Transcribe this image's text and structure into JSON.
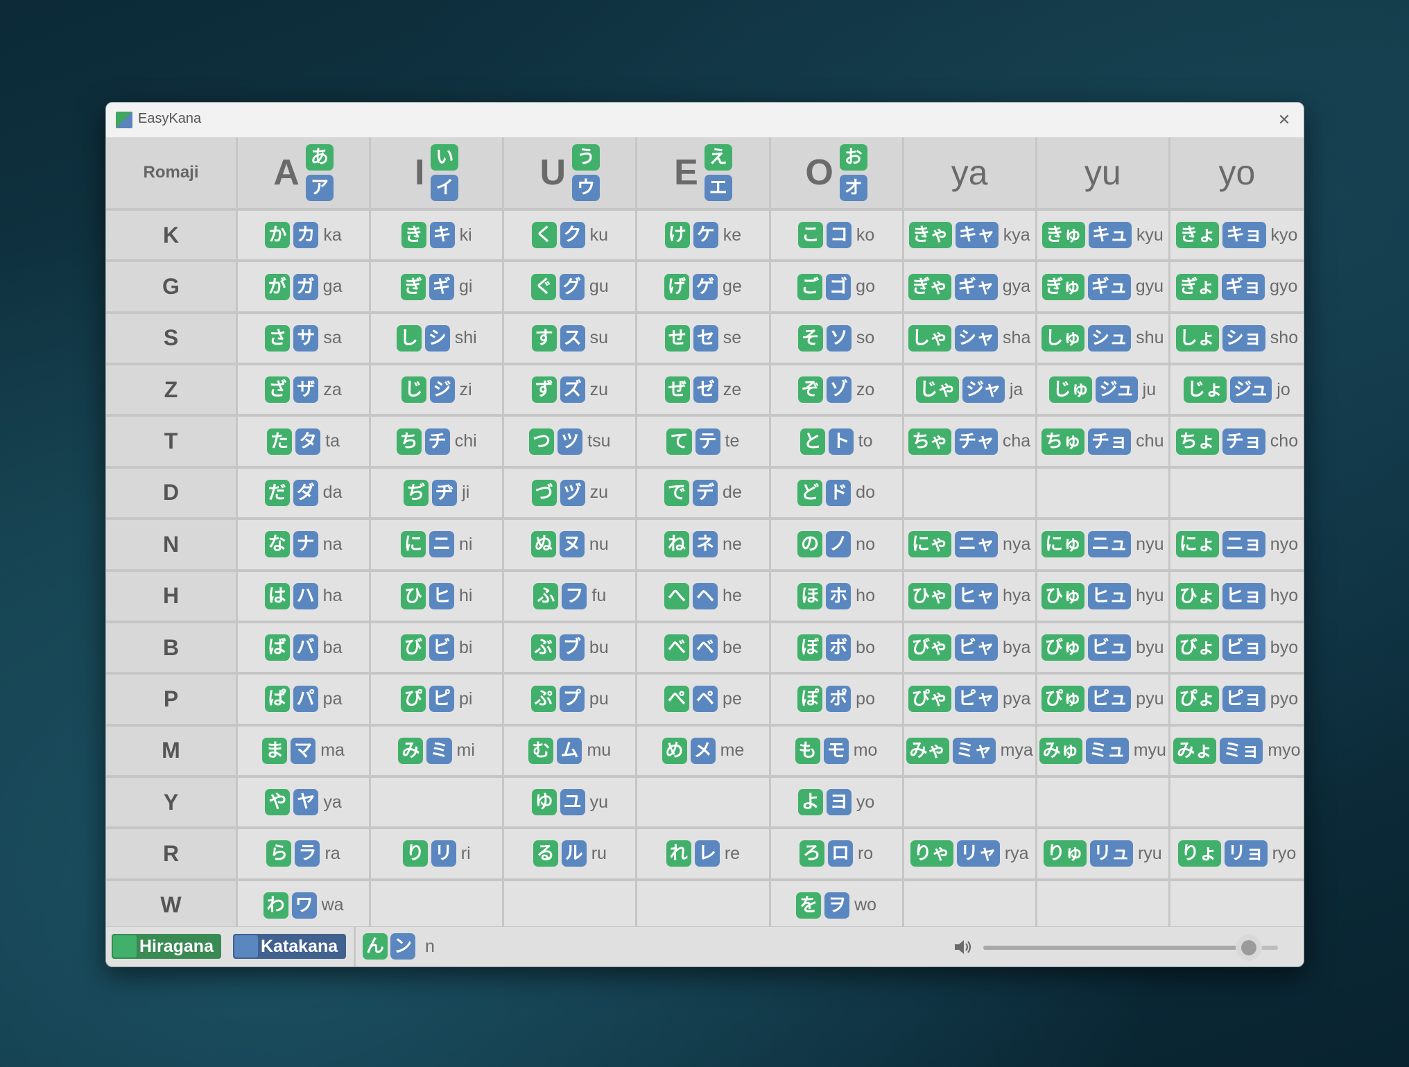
{
  "window": {
    "title": "EasyKana",
    "close_glyph": "✕"
  },
  "table": {
    "romaji_header": "Romaji",
    "columns": [
      {
        "letter": "A",
        "hira": "あ",
        "kata": "ア"
      },
      {
        "letter": "I",
        "hira": "い",
        "kata": "イ"
      },
      {
        "letter": "U",
        "hira": "う",
        "kata": "ウ"
      },
      {
        "letter": "E",
        "hira": "え",
        "kata": "エ"
      },
      {
        "letter": "O",
        "hira": "お",
        "kata": "オ"
      },
      {
        "label": "ya"
      },
      {
        "label": "yu"
      },
      {
        "label": "yo"
      }
    ],
    "rows": [
      {
        "label": "K",
        "cells": [
          {
            "h": "か",
            "k": "カ",
            "r": "ka"
          },
          {
            "h": "き",
            "k": "キ",
            "r": "ki"
          },
          {
            "h": "く",
            "k": "ク",
            "r": "ku"
          },
          {
            "h": "け",
            "k": "ケ",
            "r": "ke"
          },
          {
            "h": "こ",
            "k": "コ",
            "r": "ko"
          },
          {
            "h": "きゃ",
            "k": "キャ",
            "r": "kya"
          },
          {
            "h": "きゅ",
            "k": "キュ",
            "r": "kyu"
          },
          {
            "h": "きょ",
            "k": "キョ",
            "r": "kyo"
          }
        ]
      },
      {
        "label": "G",
        "cells": [
          {
            "h": "が",
            "k": "ガ",
            "r": "ga"
          },
          {
            "h": "ぎ",
            "k": "ギ",
            "r": "gi"
          },
          {
            "h": "ぐ",
            "k": "グ",
            "r": "gu"
          },
          {
            "h": "げ",
            "k": "ゲ",
            "r": "ge"
          },
          {
            "h": "ご",
            "k": "ゴ",
            "r": "go"
          },
          {
            "h": "ぎゃ",
            "k": "ギャ",
            "r": "gya"
          },
          {
            "h": "ぎゅ",
            "k": "ギュ",
            "r": "gyu"
          },
          {
            "h": "ぎょ",
            "k": "ギョ",
            "r": "gyo"
          }
        ]
      },
      {
        "label": "S",
        "cells": [
          {
            "h": "さ",
            "k": "サ",
            "r": "sa"
          },
          {
            "h": "し",
            "k": "シ",
            "r": "shi"
          },
          {
            "h": "す",
            "k": "ス",
            "r": "su"
          },
          {
            "h": "せ",
            "k": "セ",
            "r": "se"
          },
          {
            "h": "そ",
            "k": "ソ",
            "r": "so"
          },
          {
            "h": "しゃ",
            "k": "シャ",
            "r": "sha"
          },
          {
            "h": "しゅ",
            "k": "シュ",
            "r": "shu"
          },
          {
            "h": "しょ",
            "k": "ショ",
            "r": "sho"
          }
        ]
      },
      {
        "label": "Z",
        "cells": [
          {
            "h": "ざ",
            "k": "ザ",
            "r": "za"
          },
          {
            "h": "じ",
            "k": "ジ",
            "r": "zi"
          },
          {
            "h": "ず",
            "k": "ズ",
            "r": "zu"
          },
          {
            "h": "ぜ",
            "k": "ゼ",
            "r": "ze"
          },
          {
            "h": "ぞ",
            "k": "ゾ",
            "r": "zo"
          },
          {
            "h": "じゃ",
            "k": "ジャ",
            "r": "ja"
          },
          {
            "h": "じゅ",
            "k": "ジュ",
            "r": "ju"
          },
          {
            "h": "じょ",
            "k": "ジュ",
            "r": "jo"
          }
        ]
      },
      {
        "label": "T",
        "cells": [
          {
            "h": "た",
            "k": "タ",
            "r": "ta"
          },
          {
            "h": "ち",
            "k": "チ",
            "r": "chi"
          },
          {
            "h": "つ",
            "k": "ツ",
            "r": "tsu"
          },
          {
            "h": "て",
            "k": "テ",
            "r": "te"
          },
          {
            "h": "と",
            "k": "ト",
            "r": "to"
          },
          {
            "h": "ちゃ",
            "k": "チャ",
            "r": "cha"
          },
          {
            "h": "ちゅ",
            "k": "チョ",
            "r": "chu"
          },
          {
            "h": "ちょ",
            "k": "チョ",
            "r": "cho"
          }
        ]
      },
      {
        "label": "D",
        "cells": [
          {
            "h": "だ",
            "k": "ダ",
            "r": "da"
          },
          {
            "h": "ぢ",
            "k": "ヂ",
            "r": "ji"
          },
          {
            "h": "づ",
            "k": "ヅ",
            "r": "zu"
          },
          {
            "h": "で",
            "k": "デ",
            "r": "de"
          },
          {
            "h": "ど",
            "k": "ド",
            "r": "do"
          },
          null,
          null,
          null
        ]
      },
      {
        "label": "N",
        "cells": [
          {
            "h": "な",
            "k": "ナ",
            "r": "na"
          },
          {
            "h": "に",
            "k": "ニ",
            "r": "ni"
          },
          {
            "h": "ぬ",
            "k": "ヌ",
            "r": "nu"
          },
          {
            "h": "ね",
            "k": "ネ",
            "r": "ne"
          },
          {
            "h": "の",
            "k": "ノ",
            "r": "no"
          },
          {
            "h": "にゃ",
            "k": "ニャ",
            "r": "nya"
          },
          {
            "h": "にゅ",
            "k": "ニュ",
            "r": "nyu"
          },
          {
            "h": "にょ",
            "k": "ニョ",
            "r": "nyo"
          }
        ]
      },
      {
        "label": "H",
        "cells": [
          {
            "h": "は",
            "k": "ハ",
            "r": "ha"
          },
          {
            "h": "ひ",
            "k": "ヒ",
            "r": "hi"
          },
          {
            "h": "ふ",
            "k": "フ",
            "r": "fu"
          },
          {
            "h": "へ",
            "k": "ヘ",
            "r": "he"
          },
          {
            "h": "ほ",
            "k": "ホ",
            "r": "ho"
          },
          {
            "h": "ひゃ",
            "k": "ヒャ",
            "r": "hya"
          },
          {
            "h": "ひゅ",
            "k": "ヒュ",
            "r": "hyu"
          },
          {
            "h": "ひょ",
            "k": "ヒョ",
            "r": "hyo"
          }
        ]
      },
      {
        "label": "B",
        "cells": [
          {
            "h": "ば",
            "k": "バ",
            "r": "ba"
          },
          {
            "h": "び",
            "k": "ビ",
            "r": "bi"
          },
          {
            "h": "ぶ",
            "k": "ブ",
            "r": "bu"
          },
          {
            "h": "べ",
            "k": "ベ",
            "r": "be"
          },
          {
            "h": "ぼ",
            "k": "ボ",
            "r": "bo"
          },
          {
            "h": "びゃ",
            "k": "ビャ",
            "r": "bya"
          },
          {
            "h": "びゅ",
            "k": "ビュ",
            "r": "byu"
          },
          {
            "h": "びょ",
            "k": "ビョ",
            "r": "byo"
          }
        ]
      },
      {
        "label": "P",
        "cells": [
          {
            "h": "ぱ",
            "k": "パ",
            "r": "pa"
          },
          {
            "h": "ぴ",
            "k": "ピ",
            "r": "pi"
          },
          {
            "h": "ぷ",
            "k": "プ",
            "r": "pu"
          },
          {
            "h": "ぺ",
            "k": "ペ",
            "r": "pe"
          },
          {
            "h": "ぽ",
            "k": "ポ",
            "r": "po"
          },
          {
            "h": "ぴゃ",
            "k": "ピャ",
            "r": "pya"
          },
          {
            "h": "ぴゅ",
            "k": "ピュ",
            "r": "pyu"
          },
          {
            "h": "ぴょ",
            "k": "ピョ",
            "r": "pyo"
          }
        ]
      },
      {
        "label": "M",
        "cells": [
          {
            "h": "ま",
            "k": "マ",
            "r": "ma"
          },
          {
            "h": "み",
            "k": "ミ",
            "r": "mi"
          },
          {
            "h": "む",
            "k": "ム",
            "r": "mu"
          },
          {
            "h": "め",
            "k": "メ",
            "r": "me"
          },
          {
            "h": "も",
            "k": "モ",
            "r": "mo"
          },
          {
            "h": "みゃ",
            "k": "ミャ",
            "r": "mya"
          },
          {
            "h": "みゅ",
            "k": "ミュ",
            "r": "myu"
          },
          {
            "h": "みょ",
            "k": "ミョ",
            "r": "myo"
          }
        ]
      },
      {
        "label": "Y",
        "cells": [
          {
            "h": "や",
            "k": "ヤ",
            "r": "ya"
          },
          null,
          {
            "h": "ゆ",
            "k": "ユ",
            "r": "yu"
          },
          null,
          {
            "h": "よ",
            "k": "ヨ",
            "r": "yo"
          },
          null,
          null,
          null
        ]
      },
      {
        "label": "R",
        "cells": [
          {
            "h": "ら",
            "k": "ラ",
            "r": "ra"
          },
          {
            "h": "り",
            "k": "リ",
            "r": "ri"
          },
          {
            "h": "る",
            "k": "ル",
            "r": "ru"
          },
          {
            "h": "れ",
            "k": "レ",
            "r": "re"
          },
          {
            "h": "ろ",
            "k": "ロ",
            "r": "ro"
          },
          {
            "h": "りゃ",
            "k": "リャ",
            "r": "rya"
          },
          {
            "h": "りゅ",
            "k": "リュ",
            "r": "ryu"
          },
          {
            "h": "りょ",
            "k": "リョ",
            "r": "ryo"
          }
        ]
      },
      {
        "label": "W",
        "cells": [
          {
            "h": "わ",
            "k": "ワ",
            "r": "wa"
          },
          null,
          null,
          null,
          {
            "h": "を",
            "k": "ヲ",
            "r": "wo"
          },
          null,
          null,
          null
        ]
      }
    ]
  },
  "footer": {
    "hiragana_label": "Hiragana",
    "katakana_label": "Katakana",
    "n": {
      "h": "ん",
      "k": "ン",
      "r": "n"
    },
    "volume_icon": "speaker-icon",
    "volume_level": 0.9
  },
  "colors": {
    "hiragana": "#41b06a",
    "katakana": "#5b87c0"
  }
}
